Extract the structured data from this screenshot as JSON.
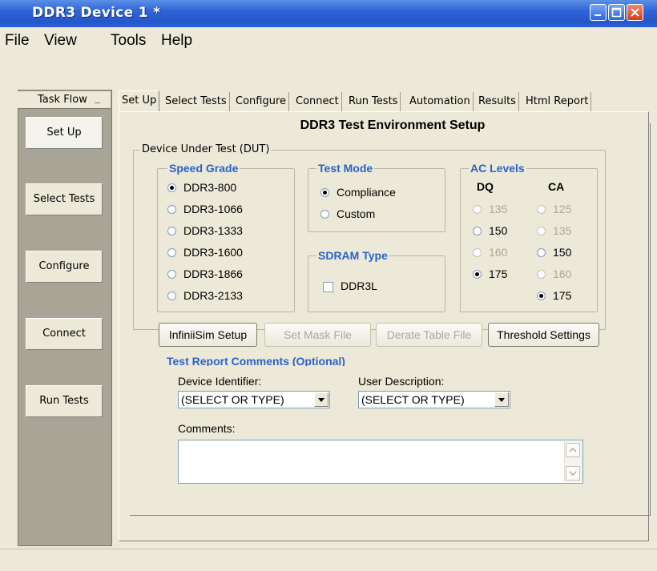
{
  "window": {
    "title": "DDR3 Device 1 *"
  },
  "menu": [
    "File",
    "View",
    "Tools",
    "Help"
  ],
  "task_flow": {
    "title": "Task Flow",
    "buttons": [
      "Set Up",
      "Select Tests",
      "Configure",
      "Connect",
      "Run Tests"
    ],
    "active": "Set Up"
  },
  "tabs": [
    "Set Up",
    "Select Tests",
    "Configure",
    "Connect",
    "Run Tests",
    "Automation",
    "Results",
    "Html Report"
  ],
  "active_tab": "Set Up",
  "setup": {
    "heading": "DDR3 Test Environment Setup",
    "dut_group": "Device Under Test (DUT)",
    "speed_grade": {
      "title": "Speed Grade",
      "options": [
        "DDR3-800",
        "DDR3-1066",
        "DDR3-1333",
        "DDR3-1600",
        "DDR3-1866",
        "DDR3-2133"
      ],
      "selected": "DDR3-800"
    },
    "test_mode": {
      "title": "Test Mode",
      "options": [
        "Compliance",
        "Custom"
      ],
      "selected": "Compliance"
    },
    "sdram_type": {
      "title": "SDRAM Type",
      "checkbox": "DDR3L",
      "checked": false
    },
    "ac_levels": {
      "title": "AC Levels",
      "dq": {
        "header": "DQ",
        "options": [
          "135",
          "150",
          "160",
          "175"
        ],
        "enabled": [
          "150",
          "175"
        ],
        "selected": "175"
      },
      "ca": {
        "header": "CA",
        "options": [
          "125",
          "135",
          "150",
          "160",
          "175"
        ],
        "enabled": [
          "150",
          "175"
        ],
        "selected": "175"
      }
    },
    "buttons": {
      "infiniisim": "InfiniiSim Setup",
      "mask": "Set Mask File",
      "derate": "Derate Table File",
      "threshold": "Threshold Settings"
    },
    "report": {
      "title": "Test Report Comments (Optional)",
      "device_identifier_label": "Device Identifier:",
      "device_identifier_value": "(SELECT OR TYPE)",
      "user_description_label": "User Description:",
      "user_description_value": "(SELECT OR TYPE)",
      "comments_label": "Comments:",
      "comments_value": ""
    }
  },
  "colors": {
    "titlebar": "#2457c9",
    "group_title_blue": "#2b62c8",
    "window_bg": "#ece9d8",
    "taskflow_bg": "#a8a597"
  }
}
